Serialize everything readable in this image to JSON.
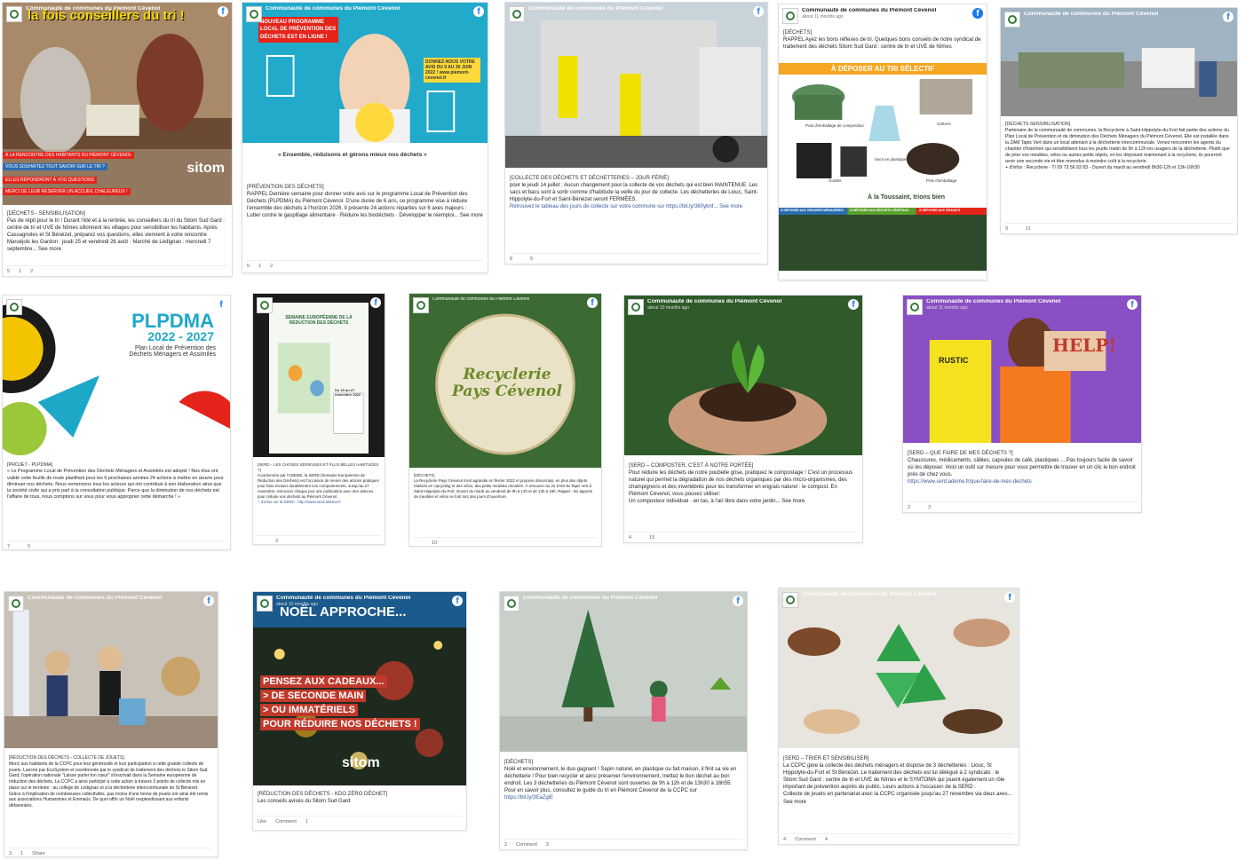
{
  "page_name": "Communauté de communes du Piémont Cévenol",
  "colors": {
    "fb_blue": "#1877f2",
    "link": "#385898",
    "green": "#3a7a3a",
    "sitom_red": "#e4241b"
  },
  "reactions": {
    "comment": "Comment",
    "like": "Like",
    "share": "Share"
  },
  "posts": [
    {
      "title_overlay": "la fois conseillers du tri !",
      "bands": [
        "À LA RENCONTRE DES HABITANTS DU PIÉMONT CÉVENOL",
        "VOUS SOUHAITEZ TOUT SAVOIR SUR LE TRI ?",
        "ELLES RÉPONDRONT À VOS QUESTIONS",
        "MERCI DE LEUR RÉSERVER UN ACCUEIL CHALEUREUX !"
      ],
      "brand": "sitom",
      "tag": "[DÉCHETS - SENSIBILISATION]",
      "body": "Pas de répit pour le tri ! Durant l'été et à la rentrée, les conseillers du tri du Sitom Sud Gard : centre de tri et UVE de Nîmes sillonnent les villages pour sensibiliser les habitants. Après Cassagnoles et St Bénézet, préparez vos questions, elles viennent à votre rencontre",
      "extra": "Maruéjols les Gardon : jeudi 25 et vendredi 26 août · Marché de Lédignan : mercredi 7 septembre... See more",
      "likes": "5",
      "comments": "1",
      "shares": "2"
    },
    {
      "title_overlay": "NOUVEAU PROGRAMME LOCAL DE PRÉVENTION DES DÉCHETS EST EN LIGNE !",
      "side_text": "DONNEZ-NOUS VOTRE AVIS DU 9 AU 30 JUIN 2022 ! www.piemont-cevenol.fr",
      "slogan": "« Ensemble, réduisons et gérons mieux nos déchets »",
      "tag": "[PRÉVENTION DES DÉCHETS]",
      "body": "RAPPEL Dernière semaine pour donner votre avis sur le programme Local de Prévention des Déchets (PLPDMA) du Piémont Cévenol. D'une durée de 6 ans, ce programme vise à réduire l'ensemble des déchets à l'horizon 2026. Il présente 24 actions réparties sur 6 axes majeurs :",
      "extra": "Lutter contre le gaspillage alimentaire · Réduire les biodéchets · Développer le réemploi... See more",
      "likes": "5",
      "comments": "1",
      "shares": "2"
    },
    {
      "tag": "[COLLECTE DES DÉCHETS ET DÉCHETTERIES – JOUR FÉRIÉ]",
      "body": "pour le jeudi 14 juillet : Aucun changement pour la collecte de vos déchets qui est bien MAINTENUE. Les sacs et bacs sont à sortir comme d'habitude la veille du jour de collecte. Les déchetteries de Liouc, Saint-Hippolyte-du-Fort et Saint-Bénézet seront FERMÉES.",
      "extra": "Retrouvez le tableau des jours de collecte sur votre commune sur https://bit.ly/360ybnf... See more",
      "likes": "8",
      "comments": "",
      "shares": "5"
    },
    {
      "time": "about 11 months ago",
      "tag": "[DÉCHETS]",
      "body": "RAPPEL Ayez les bons réflexes de tri. Quelques bons conseils de notre syndicat de traitement des déchets Sitom Sud Gard : centre de tri et UVE de Nîmes",
      "banner": "À DÉPOSER AU TRI SÉLECTIF",
      "items": [
        "Pots d'emballage de composition",
        "Sacs en plastique",
        "Cartons",
        "Godets",
        "Pots d'emballage"
      ],
      "footer": "À la Toussaint, trions bien",
      "subs": [
        "À DÉPOSER AUX ORDURES MÉNAGÈRES",
        "À DÉPOSER AUX DÉCHETS VÉGÉTAUX",
        "À DÉPOSER AUX GRAVATS"
      ],
      "likes": "",
      "comments": "",
      "shares": ""
    },
    {
      "tag": "[DÉCHETS-SENSIBILISATION]",
      "body": "Partenaire de la communauté de communes, la Recyclerie à Saint-Hippolyte-du-Fort fait partie des actions du Plan Local de Prévention et de diminution des Déchets Ménagers du Piémont Cévenol. Elle est installée dans la ZAM Tapis Vert dans un local attenant à la déchetterie intercommunale. Venez rencontrer les agents du chantier d'insertion qui sensibilisent tous les jeudis matin de 9h à 12h les usagers de la déchetterie. Plutôt que de jeter vos meubles, vélos ou autres petits objets, en les déposant maintenant à la recyclerie, ils pourront avoir une seconde vie et être revendus à moindre coût à la recyclerie.",
      "extra": "+ d'infos : Recyclerie - T/ 09 73 56 93 83 - Ouvert du mardi au vendredi 8h30-12h et 13h-16h30",
      "likes": "9",
      "comments": "",
      "shares": "11"
    },
    {
      "title_overlay": "PLPDMA",
      "subtitle": "2022 - 2027",
      "desc": "Plan Local de Prévention des Déchets Ménagers et Assimilés",
      "tag": "[PROJET - PLPDMA]",
      "body": "« Le Programme Local de Prévention des Déchets Ménagers et Assimilés est adopté ! Nos élus ont validé cette feuille de route planifiant pour les 6 prochaines années 24 actions à mettre en œuvre pour diminuer nos déchets. Nous remercions tous les acteurs qui ont contribué à son élaboration ainsi que la société civile qui a pris part à la consultation publique. Parce que la diminution de nos déchets est l'affaire de tous, nous comptons sur vous pour vous approprier cette démarche ! »",
      "likes": "7",
      "comments": "",
      "shares": "5"
    },
    {
      "poster_title": "SEMAINE EUROPÉENNE DE LA RÉDUCTION DES DÉCHETS",
      "poster_date": "Du 19 au 27 novembre 2022",
      "tag": "[SERD – LES CHOSES SÉRIEUSES ET PLUS BELLES HABITUDES ?]",
      "body": "Coordonnée par l'ADEME, la SERD (Semaine Européenne de Réduction des Déchets) est l'occasion de mener des actions pratiques pour faire évoluer durablement nos comportements. Jusqu'au 27 novembre, retrouvez chaque jour une publication avec des astuces pour réduire vos déchets au Piémont Cévenol.",
      "extra": "+ d'infos sur la SERD : http://www.serd.ademe.fr",
      "likes": "",
      "comments": "",
      "shares": "3"
    },
    {
      "logo_text": "Recyclerie Pays Cévenol",
      "tag": "[DÉCHETS]",
      "body": "La Recyclerie Pays Cévenol s'est agrandie en février 2022 et propose désormais, en plus des objets réalisés en Upcycling et des vélos, des petits meubles relookés. À retrouver au 22 ZAM du Tapis Vert à Saint-Hippolyte-du-Fort. Ouvert du mardi au vendredi de 9h à 12h et de 13h à 16h. Rappel : les apports de meubles et vélos se font lors des jours d'ouverture.",
      "likes": "",
      "comments": "",
      "shares": "10"
    },
    {
      "time": "about 10 months ago",
      "tag": "[SERD – COMPOSTER, C'EST À NOTRE PORTÉE]",
      "body": "Pour réduire les déchets de notre poubelle grise, pratiquez le compostage ! C'est un processus naturel qui permet la dégradation de nos déchets organiques par des micro-organismes, des champignons et des invertébrés pour les transformer en engrais naturel : le compost. En Piémont Cévenol, vous pouvez utiliser:",
      "extra": "Un composteur individuel · en tas, à l'air libre dans votre jardin... See more",
      "likes": "4",
      "comments": "",
      "shares": "15"
    },
    {
      "time": "about 11 months ago",
      "help": "HELP!",
      "bag_text": "RUSTIC",
      "tag": "[SERD – QUE FAIRE DE MES DÉCHETS ?]",
      "body": "Chaussures, médicaments, câbles, capsules de café, plastiques ... Pas toujours facile de savoir où les déposer. Voici un outil sur mesure pour vous permettre de trouver en un clic le bon endroit près de chez vous.",
      "extra": "https://www.serd.ademe.fr/que-faire-de-mes-dechets",
      "likes": "2",
      "comments": "",
      "shares": "3"
    },
    {
      "tag": "[RÉDUCTION DES DÉCHETS - COLLECTE DE JOUETS]",
      "body": "Merci aux habitants de la CCPC pour leur générosité et leur participation à cette grande collecte de jouets. Lancée par EcoSystem et coordonnée par le syndicat de traitement des déchets le Sitom Sud Gard, l'opération nationale \"Laisse parler ton cœur\" s'inscrivait dans la Semaine européenne de réduction des déchets. La CCPC a ainsi participé à cette action à travers 3 points de collecte mis en place sur le territoire : au collège de Lédignan et à la déchetterie intercommunale de St Bénézet.",
      "extra": "Grâce à l'implication de nombreuses collectivités, pas moins d'une tonne de jouets ont ainsi été remis aux associations Humanimes et Emmaüs. De quoi offrir un Noël resplendissant aux enfants défavorisés.",
      "likes": "3",
      "comments": "1",
      "shares": ""
    },
    {
      "time": "about 10 months ago",
      "title_overlay": "NOËL APPROCHE...",
      "lines": [
        "PENSEZ AUX CADEAUX...",
        "> DE SECONDE MAIN",
        "> OU IMMATÉRIELS",
        "POUR RÉDUIRE NOS DÉCHETS !"
      ],
      "brand": "sitom",
      "tag": "[RÉDUCTION DES DÉCHETS - KDO ZÉRO DÉCHET]",
      "body": "Les conseils avisés du Sitom Sud Gard",
      "likes": "",
      "comments": "",
      "shares": "1"
    },
    {
      "tag": "[DÉCHETS]",
      "body": "Noël et environnement, le duo gagnant ! Sapin naturel, en plastique ou fait maison, il finit sa vie en déchetterie ! Pour bien recycler et ainsi préserver l'environnement, mettez le bon déchet au bon endroit. Les 3 déchetteries du Piémont Cévenol sont ouvertes de 9h à 12h et de 13h30 à 16h55. Pour en savoir plus, consultez le guide du tri en Piémont Cévenol de la CCPC sur",
      "extra": "https://bit.ly/3EaZgiE",
      "likes": "2",
      "comments": "",
      "shares": "3"
    },
    {
      "tag": "[SERD – TRIER ET SENSIBILISER]",
      "body": "La CCPC gère la collecte des déchets ménagers et dispose de 3 déchetteries : Liouc, St Hippolyte-du-Fort et St Bénézet. Le traitement des déchets est lui délégué à 2 syndicats : le Sitom Sud Gard : centre de tri et UVE de Nîmes et le SYMTOMA qui jouent également un rôle important de prévention auprès du public. Leurs actions à l'occasion de la SERD :",
      "extra": "Collecte de jouets en partenariat avec la CCPC organisée jusqu'au 27 novembre via deux axes... See more",
      "likes": "4",
      "comments": "",
      "shares": "4"
    }
  ]
}
